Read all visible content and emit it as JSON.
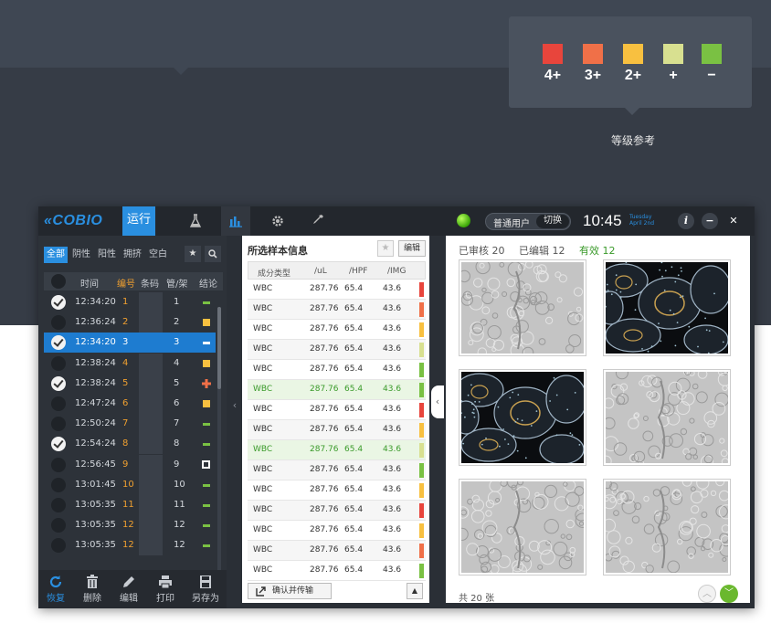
{
  "legend": {
    "items": [
      {
        "label": "4+",
        "color": "#e8453c"
      },
      {
        "label": "3+",
        "color": "#f07048"
      },
      {
        "label": "2+",
        "color": "#f8c040"
      },
      {
        "label": "+",
        "color": "#d8e090"
      },
      {
        "label": "−",
        "color": "#7ac143"
      }
    ],
    "caption": "等级参考"
  },
  "topbar": {
    "logo": "COBIO",
    "run_tab": "运行",
    "nav_icons": [
      "flask-icon",
      "chart-icon",
      "gear-icon",
      "pipette-icon"
    ],
    "user_label": "普通用户",
    "switch_label": "切换",
    "time": "10:45",
    "day": "Tuesday",
    "date": "April 2nd",
    "info_label": "i",
    "minimize_label": "−",
    "close_label": "✕"
  },
  "left": {
    "filters": [
      "全部",
      "阴性",
      "阳性",
      "拥挤",
      "空白"
    ],
    "header": {
      "time": "时间",
      "number": "编号",
      "barcode": "条码",
      "tube": "管/架",
      "conclusion": "结论"
    },
    "rows": [
      {
        "time": "12:34:20",
        "num": "1",
        "tube": "1",
        "checked": true,
        "mark": "dash",
        "mark_color": "#7ac143"
      },
      {
        "time": "12:36:24",
        "num": "2",
        "tube": "2",
        "checked": false,
        "mark": "square",
        "mark_color": "#f8c040"
      },
      {
        "time": "12:34:20",
        "num": "3",
        "tube": "3",
        "checked": true,
        "mark": "dash",
        "mark_color": "#ffffff",
        "selected": true
      },
      {
        "time": "12:38:24",
        "num": "4",
        "tube": "4",
        "checked": false,
        "mark": "square",
        "mark_color": "#f8c040"
      },
      {
        "time": "12:38:24",
        "num": "5",
        "tube": "5",
        "checked": true,
        "mark": "plus",
        "mark_color": "#f07048"
      },
      {
        "time": "12:47:24",
        "num": "6",
        "tube": "6",
        "checked": false,
        "mark": "square",
        "mark_color": "#f8c040"
      },
      {
        "time": "12:50:24",
        "num": "7",
        "tube": "7",
        "checked": false,
        "mark": "dash",
        "mark_color": "#7ac143"
      },
      {
        "time": "12:54:24",
        "num": "8",
        "tube": "8",
        "checked": true,
        "mark": "dash",
        "mark_color": "#7ac143"
      },
      {
        "time": "12:56:45",
        "num": "9",
        "tube": "9",
        "checked": false,
        "mark": "hollow",
        "mark_color": "#ffffff"
      },
      {
        "time": "13:01:45",
        "num": "10",
        "tube": "10",
        "checked": false,
        "mark": "dash",
        "mark_color": "#7ac143"
      },
      {
        "time": "13:05:35",
        "num": "11",
        "tube": "11",
        "checked": false,
        "mark": "dash",
        "mark_color": "#7ac143"
      },
      {
        "time": "13:05:35",
        "num": "12",
        "tube": "12",
        "checked": false,
        "mark": "dash",
        "mark_color": "#7ac143"
      },
      {
        "time": "13:05:35",
        "num": "12",
        "tube": "12",
        "checked": false,
        "mark": "dash",
        "mark_color": "#7ac143"
      }
    ],
    "tools": [
      {
        "label": "恢复",
        "icon": "refresh-icon"
      },
      {
        "label": "删除",
        "icon": "trash-icon"
      },
      {
        "label": "编辑",
        "icon": "pencil-icon"
      },
      {
        "label": "打印",
        "icon": "printer-icon"
      },
      {
        "label": "另存为",
        "icon": "save-icon"
      }
    ]
  },
  "mid": {
    "title": "所选样本信息",
    "edit_label": "编辑",
    "headers": [
      "成分类型",
      "/uL",
      "/HPF",
      "/IMG"
    ],
    "rows": [
      {
        "type": "WBC",
        "ul": "287.76",
        "hpf": "65.4",
        "img": "43.6",
        "color": "#e8453c"
      },
      {
        "type": "WBC",
        "ul": "287.76",
        "hpf": "65.4",
        "img": "43.6",
        "color": "#f07048"
      },
      {
        "type": "WBC",
        "ul": "287.76",
        "hpf": "65.4",
        "img": "43.6",
        "color": "#f8c040"
      },
      {
        "type": "WBC",
        "ul": "287.76",
        "hpf": "65.4",
        "img": "43.6",
        "color": "#d8e090"
      },
      {
        "type": "WBC",
        "ul": "287.76",
        "hpf": "65.4",
        "img": "43.6",
        "color": "#7ac143"
      },
      {
        "type": "WBC",
        "ul": "287.76",
        "hpf": "65.4",
        "img": "43.6",
        "color": "#7ac143",
        "hl": true
      },
      {
        "type": "WBC",
        "ul": "287.76",
        "hpf": "65.4",
        "img": "43.6",
        "color": "#e8453c"
      },
      {
        "type": "WBC",
        "ul": "287.76",
        "hpf": "65.4",
        "img": "43.6",
        "color": "#f8c040"
      },
      {
        "type": "WBC",
        "ul": "287.76",
        "hpf": "65.4",
        "img": "43.6",
        "color": "#d8e090",
        "hl": true
      },
      {
        "type": "WBC",
        "ul": "287.76",
        "hpf": "65.4",
        "img": "43.6",
        "color": "#7ac143"
      },
      {
        "type": "WBC",
        "ul": "287.76",
        "hpf": "65.4",
        "img": "43.6",
        "color": "#f8c040"
      },
      {
        "type": "WBC",
        "ul": "287.76",
        "hpf": "65.4",
        "img": "43.6",
        "color": "#e8453c"
      },
      {
        "type": "WBC",
        "ul": "287.76",
        "hpf": "65.4",
        "img": "43.6",
        "color": "#f8c040"
      },
      {
        "type": "WBC",
        "ul": "287.76",
        "hpf": "65.4",
        "img": "43.6",
        "color": "#f07048"
      },
      {
        "type": "WBC",
        "ul": "287.76",
        "hpf": "65.4",
        "img": "43.6",
        "color": "#7ac143"
      }
    ],
    "confirm_label": "确认并传输"
  },
  "right": {
    "reviewed": "已审核 20",
    "edited": "已编辑 12",
    "valid": "有效 12",
    "images": [
      {
        "kind": "gray"
      },
      {
        "kind": "cells"
      },
      {
        "kind": "cells"
      },
      {
        "kind": "gray"
      },
      {
        "kind": "gray"
      },
      {
        "kind": "gray"
      }
    ],
    "count": "共 20 张"
  }
}
